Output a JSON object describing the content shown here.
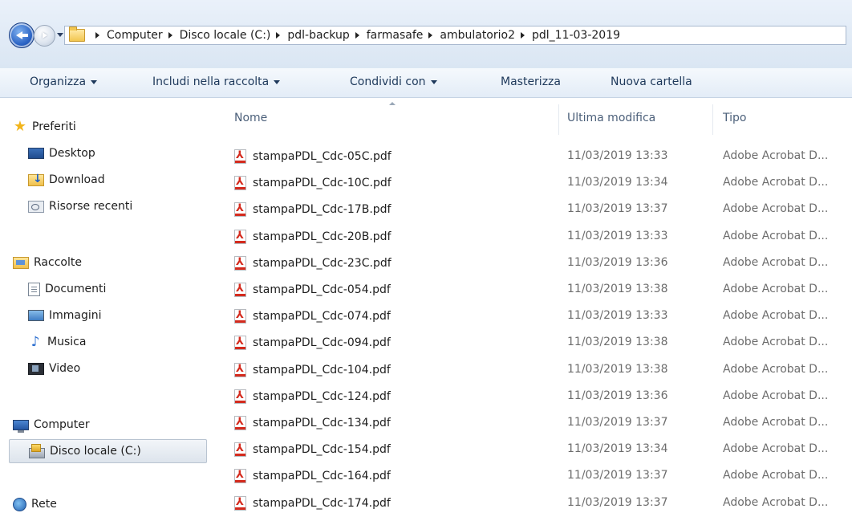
{
  "navigation": {
    "back_icon": "back-arrow-icon",
    "forward_icon": "forward-arrow-icon",
    "history_icon": "chevron-down-icon",
    "breadcrumbs": [
      "Computer",
      "Disco locale (C:)",
      "pdl-backup",
      "farmasafe",
      "ambulatorio2",
      "pdl_11-03-2019"
    ]
  },
  "toolbar": {
    "organize": "Organizza",
    "include": "Includi nella raccolta",
    "share": "Condividi con",
    "burn": "Masterizza",
    "new_folder": "Nuova cartella"
  },
  "sidebar": {
    "favorites": {
      "label": "Preferiti",
      "items": [
        "Desktop",
        "Download",
        "Risorse recenti"
      ]
    },
    "libraries": {
      "label": "Raccolte",
      "items": [
        "Documenti",
        "Immagini",
        "Musica",
        "Video"
      ]
    },
    "computer": {
      "label": "Computer",
      "items": [
        "Disco locale (C:)"
      ]
    },
    "network": {
      "label": "Rete"
    }
  },
  "filelist": {
    "columns": {
      "name": "Nome",
      "modified": "Ultima modifica",
      "type": "Tipo"
    },
    "rows": [
      {
        "name": "stampaPDL_Cdc-05C.pdf",
        "modified": "11/03/2019 13:33",
        "type": "Adobe Acrobat D..."
      },
      {
        "name": "stampaPDL_Cdc-10C.pdf",
        "modified": "11/03/2019 13:34",
        "type": "Adobe Acrobat D..."
      },
      {
        "name": "stampaPDL_Cdc-17B.pdf",
        "modified": "11/03/2019 13:37",
        "type": "Adobe Acrobat D..."
      },
      {
        "name": "stampaPDL_Cdc-20B.pdf",
        "modified": "11/03/2019 13:33",
        "type": "Adobe Acrobat D..."
      },
      {
        "name": "stampaPDL_Cdc-23C.pdf",
        "modified": "11/03/2019 13:36",
        "type": "Adobe Acrobat D..."
      },
      {
        "name": "stampaPDL_Cdc-054.pdf",
        "modified": "11/03/2019 13:38",
        "type": "Adobe Acrobat D..."
      },
      {
        "name": "stampaPDL_Cdc-074.pdf",
        "modified": "11/03/2019 13:33",
        "type": "Adobe Acrobat D..."
      },
      {
        "name": "stampaPDL_Cdc-094.pdf",
        "modified": "11/03/2019 13:38",
        "type": "Adobe Acrobat D..."
      },
      {
        "name": "stampaPDL_Cdc-104.pdf",
        "modified": "11/03/2019 13:38",
        "type": "Adobe Acrobat D..."
      },
      {
        "name": "stampaPDL_Cdc-124.pdf",
        "modified": "11/03/2019 13:36",
        "type": "Adobe Acrobat D..."
      },
      {
        "name": "stampaPDL_Cdc-134.pdf",
        "modified": "11/03/2019 13:37",
        "type": "Adobe Acrobat D..."
      },
      {
        "name": "stampaPDL_Cdc-154.pdf",
        "modified": "11/03/2019 13:34",
        "type": "Adobe Acrobat D..."
      },
      {
        "name": "stampaPDL_Cdc-164.pdf",
        "modified": "11/03/2019 13:37",
        "type": "Adobe Acrobat D..."
      },
      {
        "name": "stampaPDL_Cdc-174.pdf",
        "modified": "11/03/2019 13:37",
        "type": "Adobe Acrobat D..."
      }
    ]
  }
}
